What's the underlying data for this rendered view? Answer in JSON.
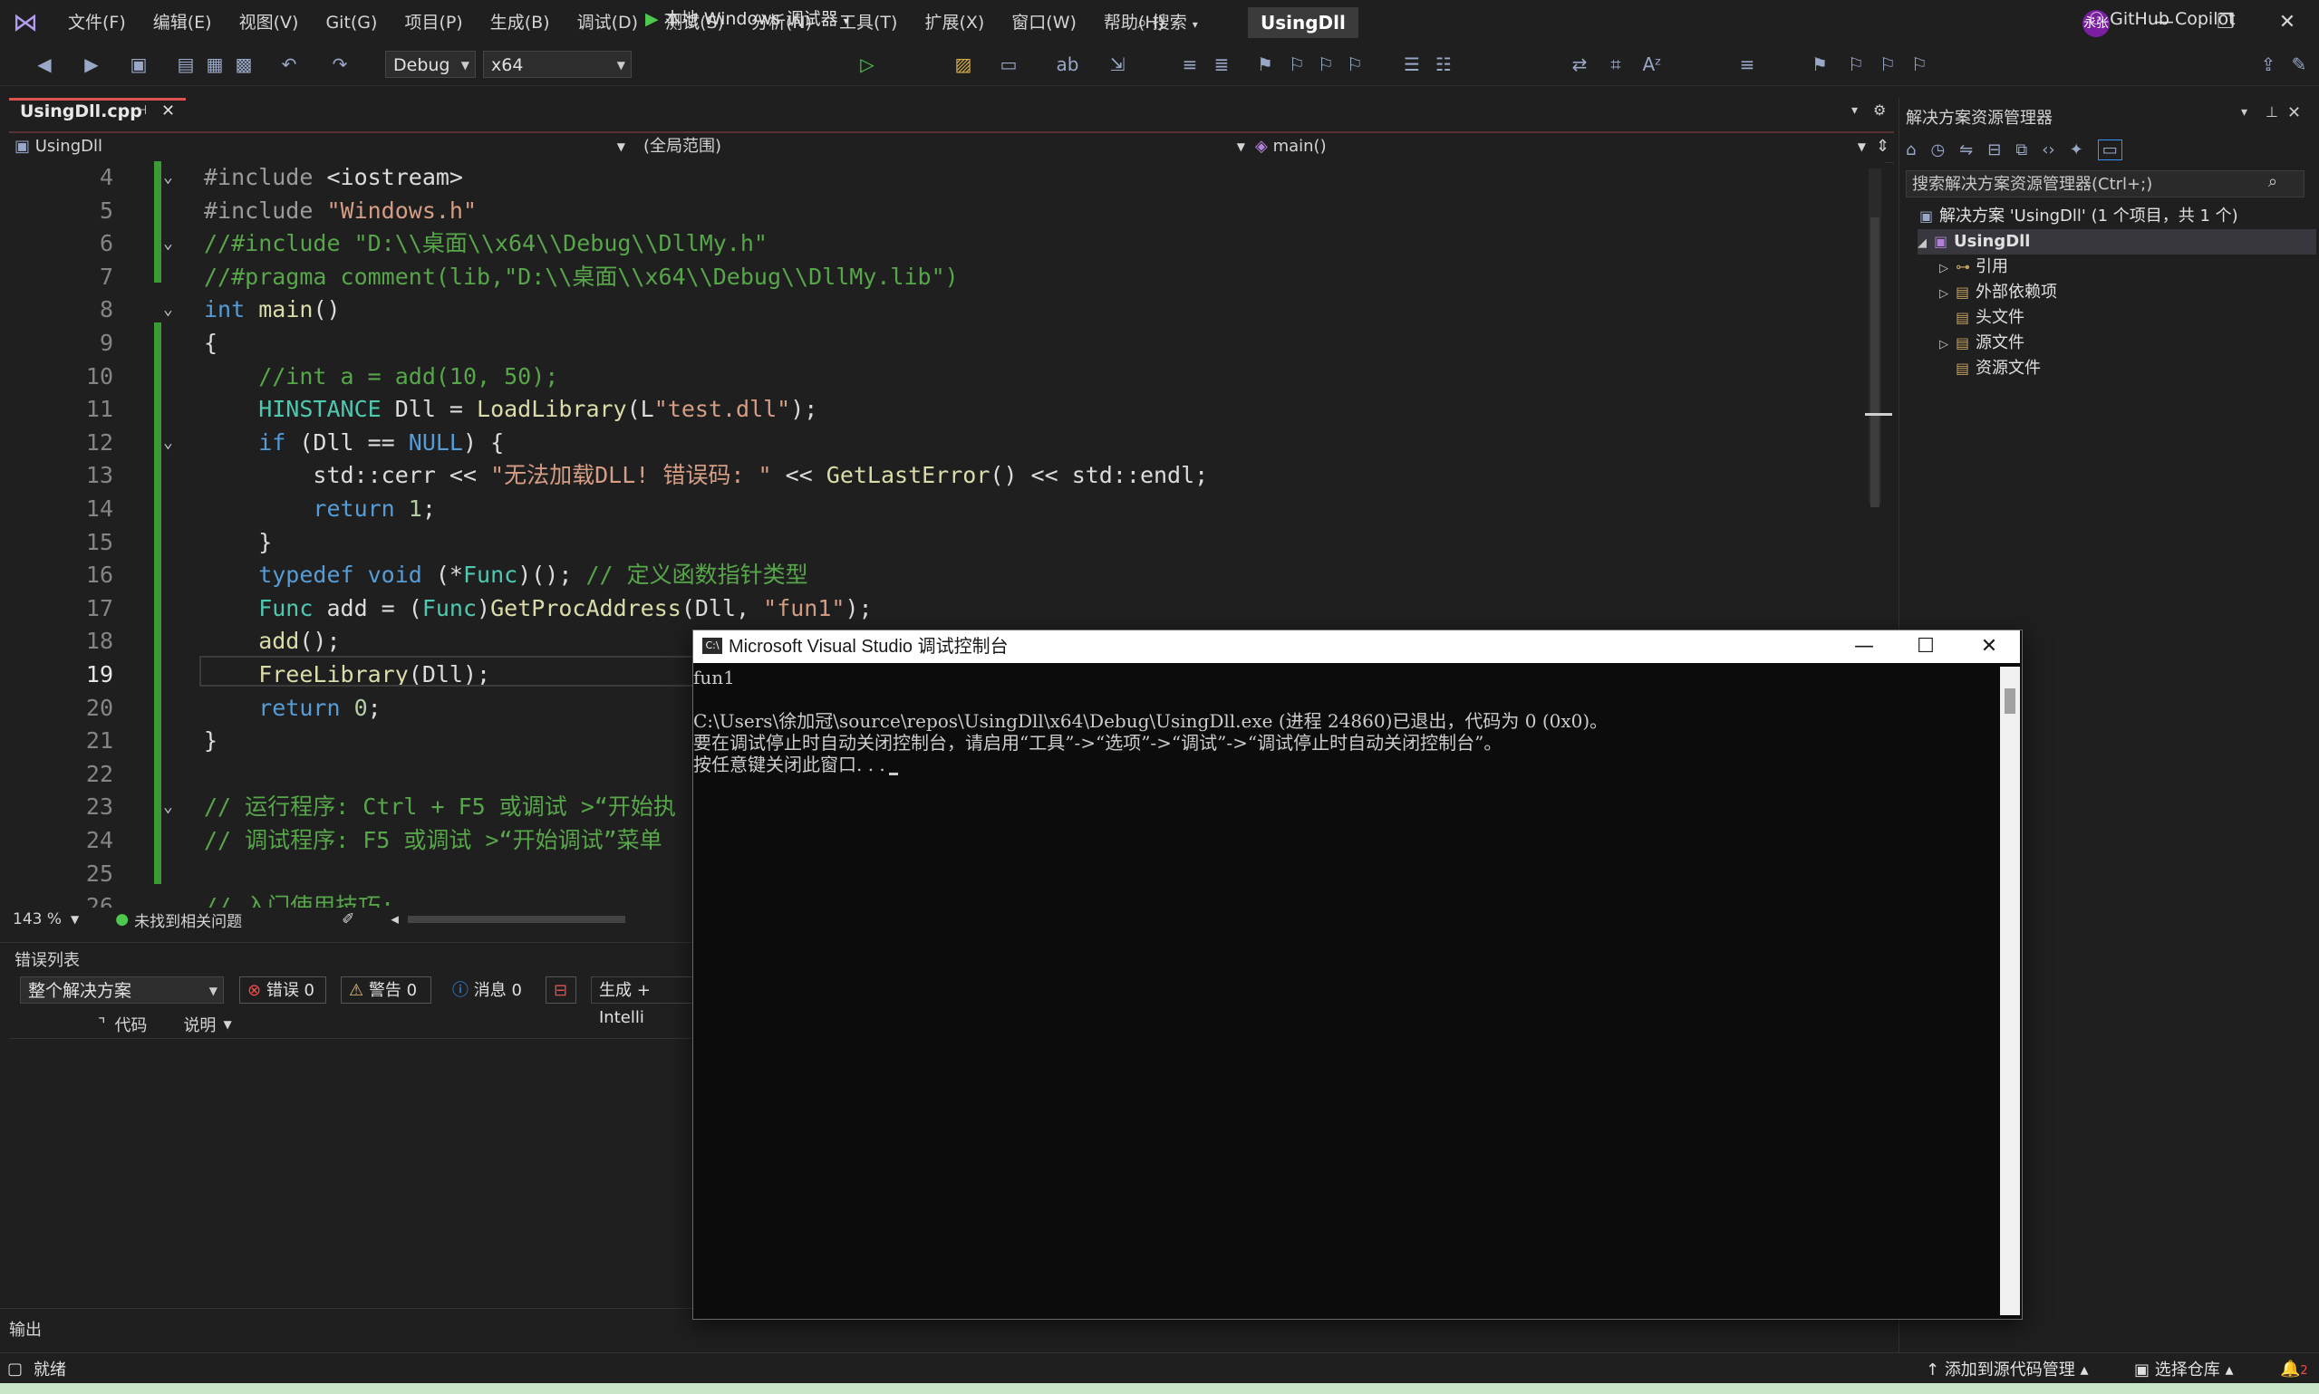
{
  "menu": {
    "items": [
      "文件(F)",
      "编辑(E)",
      "视图(V)",
      "Git(G)",
      "项目(P)",
      "生成(B)",
      "调试(D)",
      "测试(S)",
      "分析(N)",
      "工具(T)",
      "扩展(X)",
      "窗口(W)",
      "帮助(H)"
    ],
    "search_label": "搜索",
    "app_name": "UsingDll",
    "avatar_text": "永张"
  },
  "toolbar": {
    "config": "Debug",
    "platform": "x64",
    "run_label": "本地 Windows 调试器",
    "copilot_label": "GitHub Copilot"
  },
  "tab": {
    "label": "UsingDll.cpp"
  },
  "navbar": {
    "project": "UsingDll",
    "scope": "(全局范围)",
    "member": "main()"
  },
  "editor": {
    "lines": [
      {
        "n": "4",
        "parts": [
          [
            "pp",
            "#include "
          ],
          [
            "id",
            "<iostream>"
          ]
        ]
      },
      {
        "n": "5",
        "parts": [
          [
            "pp",
            "#include "
          ],
          [
            "str",
            "\"Windows.h\""
          ]
        ]
      },
      {
        "n": "6",
        "parts": [
          [
            "cm",
            "//#include \"D:\\\\桌面\\\\x64\\\\Debug\\\\DllMy.h\""
          ]
        ]
      },
      {
        "n": "7",
        "parts": [
          [
            "cm",
            "//#pragma comment(lib,\"D:\\\\桌面\\\\x64\\\\Debug\\\\DllMy.lib\")"
          ]
        ]
      },
      {
        "n": "8",
        "parts": [
          [
            "kw",
            "int "
          ],
          [
            "fn",
            "main"
          ],
          [
            "id",
            "()"
          ]
        ]
      },
      {
        "n": "9",
        "parts": [
          [
            "id",
            "{"
          ]
        ]
      },
      {
        "n": "10",
        "parts": [
          [
            "cm",
            "    //int a = add(10, 50);"
          ]
        ]
      },
      {
        "n": "11",
        "parts": [
          [
            "ty",
            "    HINSTANCE "
          ],
          [
            "id",
            "Dll = "
          ],
          [
            "fn",
            "LoadLibrary"
          ],
          [
            "id",
            "(L"
          ],
          [
            "str",
            "\"test.dll\""
          ],
          [
            "id",
            ");"
          ]
        ]
      },
      {
        "n": "12",
        "parts": [
          [
            "kw",
            "    if "
          ],
          [
            "id",
            "(Dll == "
          ],
          [
            "kw",
            "NULL"
          ],
          [
            "id",
            ") {"
          ]
        ]
      },
      {
        "n": "13",
        "parts": [
          [
            "id",
            "        std::cerr << "
          ],
          [
            "str",
            "\"无法加载DLL! 错误码: \""
          ],
          [
            "id",
            " << "
          ],
          [
            "fn",
            "GetLastError"
          ],
          [
            "id",
            "() << std::endl;"
          ]
        ]
      },
      {
        "n": "14",
        "parts": [
          [
            "kw",
            "        return "
          ],
          [
            "nm",
            "1"
          ],
          [
            "id",
            ";"
          ]
        ]
      },
      {
        "n": "15",
        "parts": [
          [
            "id",
            "    }"
          ]
        ]
      },
      {
        "n": "16",
        "parts": [
          [
            "kw",
            "    typedef void "
          ],
          [
            "id",
            "(*"
          ],
          [
            "ty",
            "Func"
          ],
          [
            "id",
            ")(); "
          ],
          [
            "cm",
            "// 定义函数指针类型"
          ]
        ]
      },
      {
        "n": "17",
        "parts": [
          [
            "ty",
            "    Func "
          ],
          [
            "id",
            "add = ("
          ],
          [
            "ty",
            "Func"
          ],
          [
            "id",
            ")"
          ],
          [
            "fn",
            "GetProcAddress"
          ],
          [
            "id",
            "(Dll, "
          ],
          [
            "str",
            "\"fun1\""
          ],
          [
            "id",
            ");"
          ]
        ]
      },
      {
        "n": "18",
        "parts": [
          [
            "fn",
            "    add"
          ],
          [
            "id",
            "();"
          ]
        ]
      },
      {
        "n": "19",
        "parts": [
          [
            "fn",
            "    FreeLibrary"
          ],
          [
            "id",
            "(Dll);"
          ]
        ]
      },
      {
        "n": "20",
        "parts": [
          [
            "kw",
            "    return "
          ],
          [
            "nm",
            "0"
          ],
          [
            "id",
            ";"
          ]
        ]
      },
      {
        "n": "21",
        "parts": [
          [
            "id",
            "}"
          ]
        ]
      },
      {
        "n": "22",
        "parts": []
      },
      {
        "n": "23",
        "parts": [
          [
            "cm",
            "// 运行程序: Ctrl + F5 或调试 >“开始执"
          ]
        ]
      },
      {
        "n": "24",
        "parts": [
          [
            "cm",
            "// 调试程序: F5 或调试 >“开始调试”菜单"
          ]
        ]
      },
      {
        "n": "25",
        "parts": []
      },
      {
        "n": "26",
        "parts": [
          [
            "cm",
            "// 入门使用技巧:"
          ]
        ]
      }
    ],
    "current_line": "19",
    "zoom": "143 %",
    "issues": "未找到相关问题"
  },
  "errorlist": {
    "title": "错误列表",
    "scope": "整个解决方案",
    "errors": "错误 0",
    "warnings": "警告 0",
    "messages": "消息 0",
    "build_filter": "生成 + Intelli",
    "col_code": "代码",
    "col_desc": "说明"
  },
  "output": {
    "title": "输出"
  },
  "status": {
    "ready": "就绪",
    "add_source": "添加到源代码管理",
    "select_repo": "选择仓库",
    "notif_count": "2"
  },
  "solution": {
    "title": "解决方案资源管理器",
    "search_placeholder": "搜索解决方案资源管理器(Ctrl+;)",
    "root": "解决方案 'UsingDll' (1 个项目，共 1 个)",
    "project": "UsingDll",
    "items": [
      "引用",
      "外部依赖项",
      "头文件",
      "源文件",
      "资源文件"
    ]
  },
  "console": {
    "title": "Microsoft Visual Studio 调试控制台",
    "lines": [
      "fun1",
      "",
      "C:\\Users\\徐加冠\\source\\repos\\UsingDll\\x64\\Debug\\UsingDll.exe (进程 24860)已退出，代码为 0 (0x0)。",
      "要在调试停止时自动关闭控制台，请启用“工具”->“选项”->“调试”->“调试停止时自动关闭控制台”。",
      "按任意键关闭此窗口. . ."
    ]
  }
}
